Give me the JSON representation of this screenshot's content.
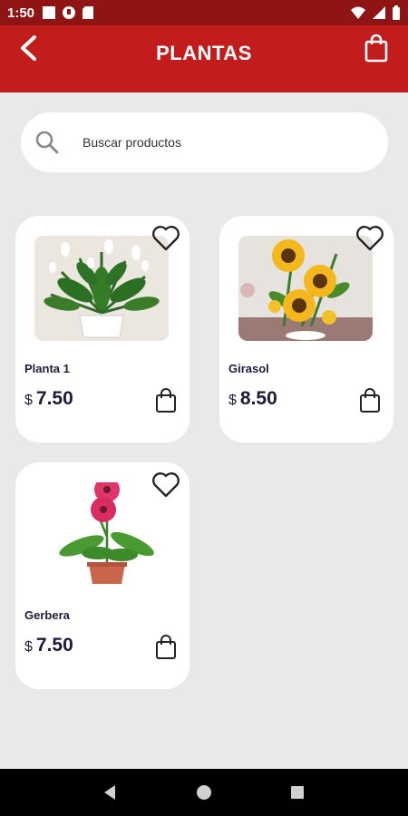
{
  "status": {
    "time": "1:50"
  },
  "header": {
    "title": "PLANTAS"
  },
  "search": {
    "placeholder": "Buscar productos"
  },
  "products": [
    {
      "name": "Planta 1",
      "currency": "$",
      "price": "7.50"
    },
    {
      "name": "Girasol",
      "currency": "$",
      "price": "8.50"
    },
    {
      "name": "Gerbera",
      "currency": "$",
      "price": "7.50"
    }
  ],
  "colors": {
    "status_bar": "#8f1515",
    "app_bar": "#c21c1c",
    "background": "#e9e9e9",
    "card": "#ffffff",
    "text_dark": "#1c1c3a"
  },
  "icons": [
    "back-arrow-icon",
    "shopping-bag-icon",
    "search-icon",
    "heart-icon",
    "bag-icon",
    "nav-back-icon",
    "nav-home-icon",
    "nav-recents-icon"
  ]
}
